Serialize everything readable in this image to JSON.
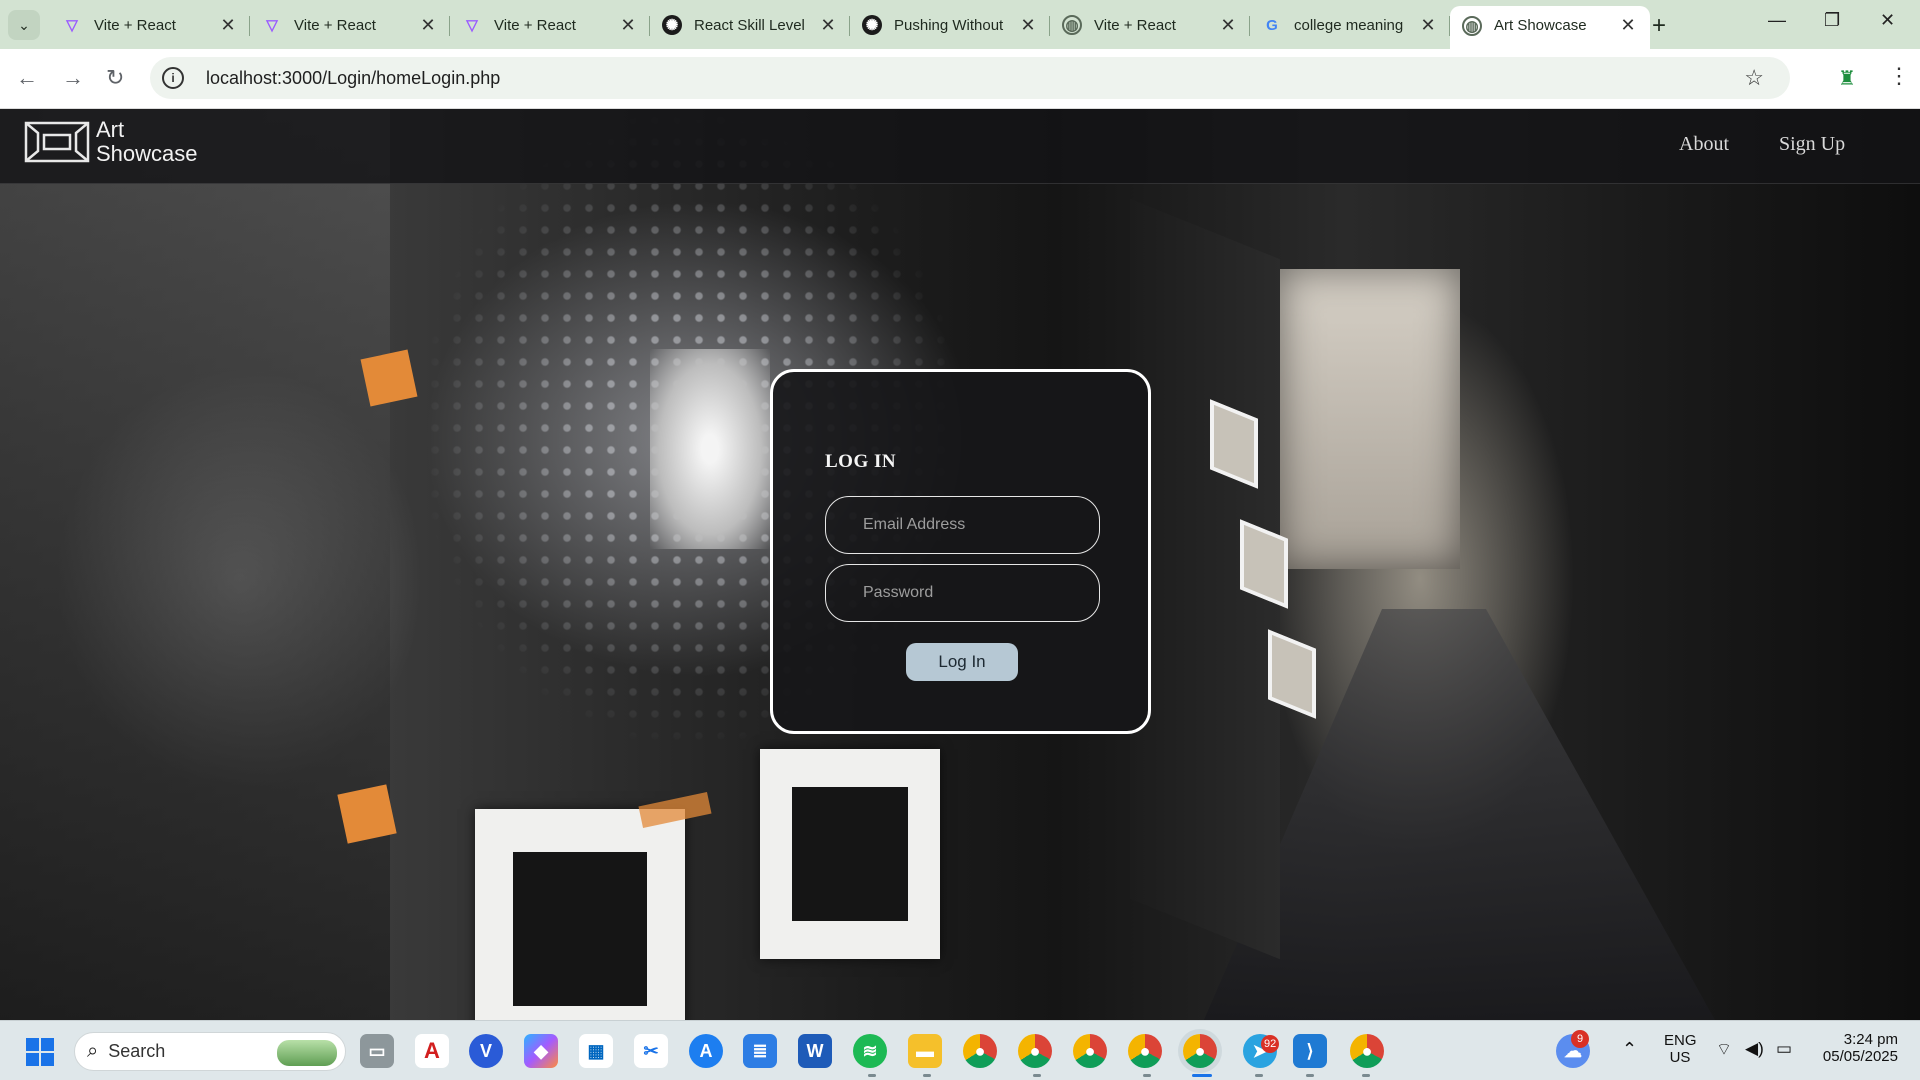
{
  "browser": {
    "tabs": [
      {
        "title": "Vite + React",
        "favicon": "vite-icon"
      },
      {
        "title": "Vite + React",
        "favicon": "vite-icon"
      },
      {
        "title": "Vite + React",
        "favicon": "vite-icon"
      },
      {
        "title": "React Skill Level",
        "favicon": "openai-icon"
      },
      {
        "title": "Pushing Without",
        "favicon": "openai-icon"
      },
      {
        "title": "Vite + React",
        "favicon": "globe-icon"
      },
      {
        "title": "college meaning",
        "favicon": "google-icon"
      },
      {
        "title": "Art Showcase",
        "favicon": "globe-icon",
        "active": true
      }
    ],
    "url": "localhost:3000/Login/homeLogin.php"
  },
  "site": {
    "logo_line1": "Art",
    "logo_line2": "Showcase",
    "nav": {
      "about": "About",
      "signup": "Sign Up"
    }
  },
  "login": {
    "title": "LOG IN",
    "email_placeholder": "Email Address",
    "password_placeholder": "Password",
    "button": "Log In"
  },
  "taskbar": {
    "search_label": "Search",
    "apps": [
      "task-view-icon",
      "acrobat-icon",
      "v-app-icon",
      "copilot-icon",
      "store-icon",
      "snipping-icon",
      "app-store-icon",
      "notepad-icon",
      "word-icon",
      "spotify-icon",
      "file-explorer-icon",
      "chrome-icon",
      "chrome-icon",
      "chrome-icon",
      "chrome-icon",
      "chrome-icon",
      "telegram-icon",
      "vscode-icon",
      "chrome-icon"
    ],
    "telegram_badge": "92",
    "weather_badge": "9",
    "lang_top": "ENG",
    "lang_bottom": "US",
    "time": "3:24 pm",
    "date": "05/05/2025"
  },
  "colors": {
    "tabstrip": "#d3e3d2",
    "login_button": "#b6c8d4",
    "card_border": "#ffffff"
  }
}
